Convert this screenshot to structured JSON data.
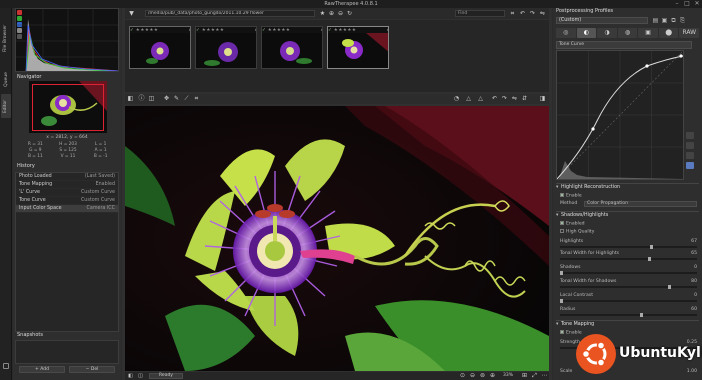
{
  "window": {
    "title": "RawTherapee 4.0.8.1",
    "controls": [
      "–",
      "□",
      "✕"
    ]
  },
  "vtabs": [
    "File Browser",
    "Queue",
    "Editor"
  ],
  "left": {
    "navigator_title": "Navigator",
    "nav_coords": "x = 2812, y = 664",
    "nav_values": [
      "R = 31",
      "H = 203",
      "L = 1",
      "G = 9",
      "S = 125",
      "A = 1",
      "B = 11",
      "V = 11",
      "B = -1"
    ],
    "history_title": "History",
    "history": [
      {
        "label": "Photo Loaded",
        "value": "(Last Saved)"
      },
      {
        "label": "Tone Mapping",
        "value": "Enabled"
      },
      {
        "label": "'L' Curve",
        "value": "Custom Curve"
      },
      {
        "label": "Tone Curve",
        "value": "Custom Curve"
      },
      {
        "label": "Input Color Space",
        "value": "Camera ICC"
      }
    ],
    "snapshots_title": "Snapshots",
    "add_label": "+ Add",
    "del_label": "− Del"
  },
  "center": {
    "path": "/media/pub/_data/photo_gungdo/2011.10.29 flower",
    "search_placeholder": "Find",
    "thumbs": [
      {
        "stars": "★★★★★",
        "check": "✓"
      },
      {
        "stars": "★★★★★",
        "check": "✓"
      },
      {
        "stars": "★★★★★",
        "check": "✓"
      },
      {
        "stars": "★★★★★",
        "check": "✓"
      }
    ],
    "status_ready": "Ready",
    "zoom": "33%"
  },
  "right": {
    "header": "Postprocessing Profiles",
    "profile": "(Custom)",
    "tabs": [
      "◎",
      "◐",
      "◑",
      "◍",
      "▣",
      "⬤",
      "RAW"
    ],
    "curve_label": "Tone Curve",
    "sections": {
      "highlight": "Highlight Reconstruction",
      "enable": "Enable",
      "method_label": "Method",
      "method_value": "Color Propagation",
      "shadows": "Shadows/Highlights",
      "enabled": "Enabled",
      "high_quality": "High Quality",
      "highlights": "Highlights",
      "highlights_val": "67",
      "tw_highlights": "Tonal Width for Highlights",
      "tw_highlights_val": "65",
      "shadows_label": "Shadows",
      "shadows_val": "0",
      "tw_shadows": "Tonal Width for Shadows",
      "tw_shadows_val": "80",
      "local_contrast": "Local Contrast",
      "local_contrast_val": "0",
      "radius": "Radius",
      "radius_val": "60",
      "tone_mapping": "Tone Mapping",
      "tm_enable": "Enable",
      "strength": "Strength",
      "strength_val": "0.25",
      "scale": "Scale",
      "scale_val": "1.00"
    }
  },
  "watermark": "UbuntuKylin",
  "colors": {
    "accent_red": "#d23030",
    "ubuntu_orange": "#e95420"
  }
}
